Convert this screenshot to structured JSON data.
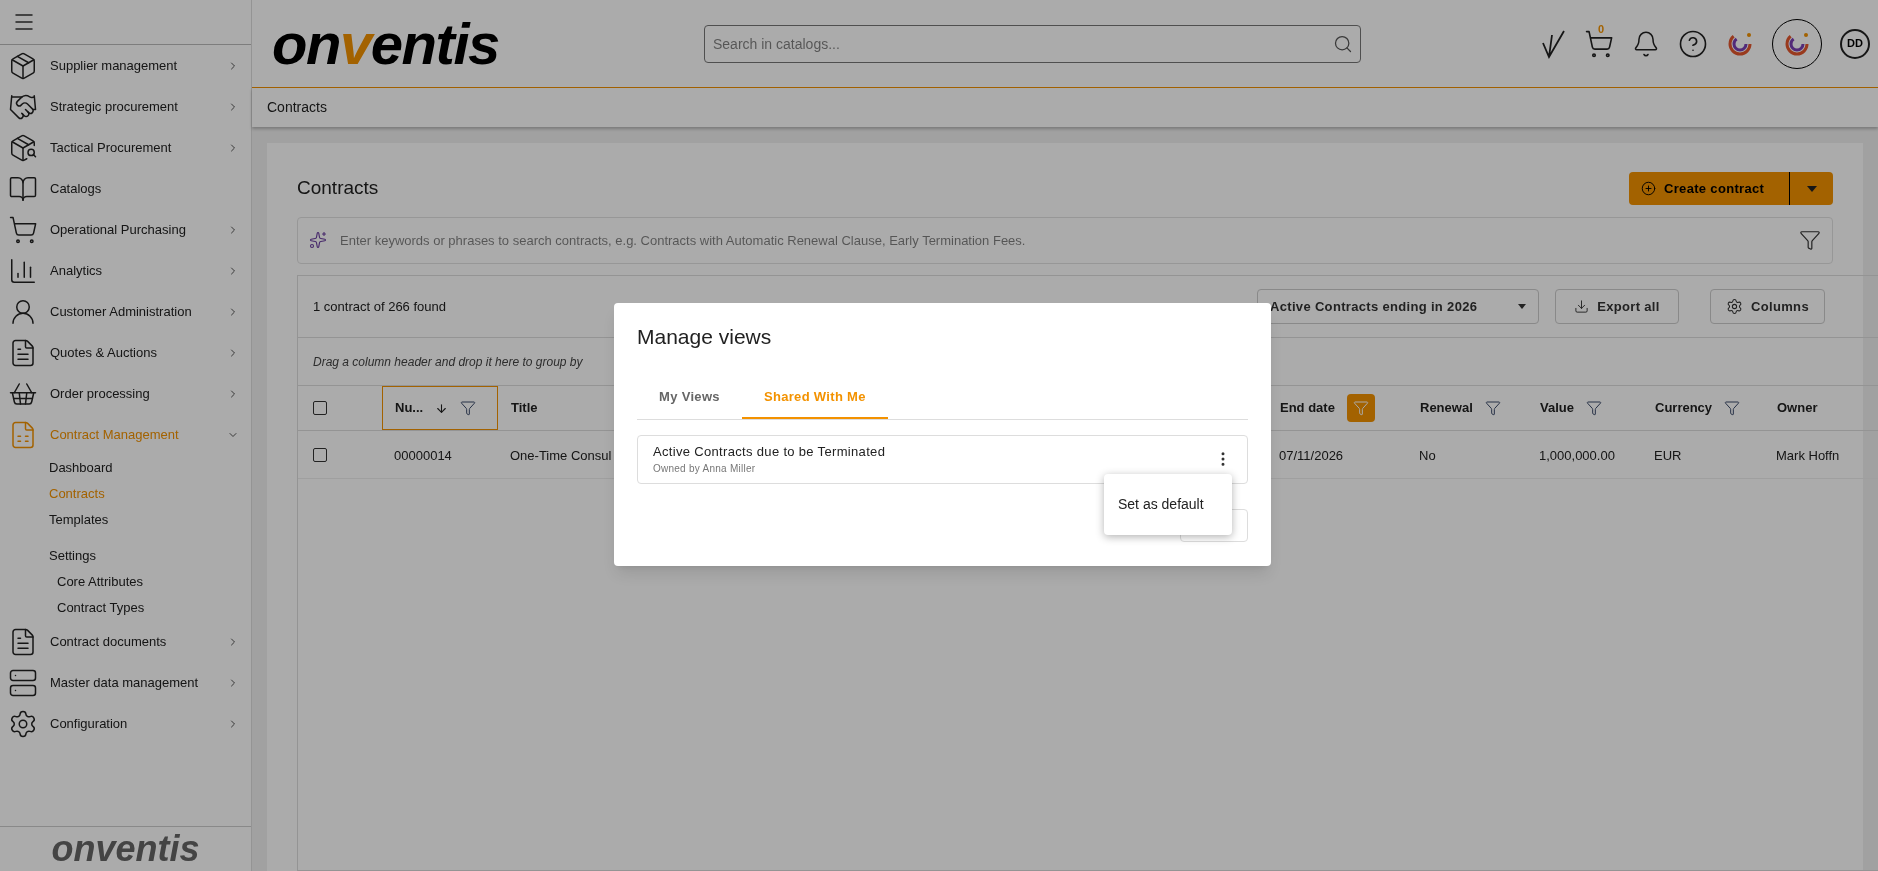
{
  "sidebar": {
    "items": [
      {
        "label": "Supplier management",
        "expandable": true,
        "expanded": false,
        "selected": false
      },
      {
        "label": "Strategic procurement",
        "expandable": true,
        "expanded": false,
        "selected": false
      },
      {
        "label": "Tactical Procurement",
        "expandable": true,
        "expanded": false,
        "selected": false
      },
      {
        "label": "Catalogs",
        "expandable": false,
        "expanded": false,
        "selected": false
      },
      {
        "label": "Operational Purchasing",
        "expandable": true,
        "expanded": false,
        "selected": false
      },
      {
        "label": "Analytics",
        "expandable": true,
        "expanded": false,
        "selected": false
      },
      {
        "label": "Customer Administration",
        "expandable": true,
        "expanded": false,
        "selected": false
      },
      {
        "label": "Quotes & Auctions",
        "expandable": true,
        "expanded": false,
        "selected": false
      },
      {
        "label": "Order processing",
        "expandable": true,
        "expanded": false,
        "selected": false
      },
      {
        "label": "Contract Management",
        "expandable": true,
        "expanded": true,
        "selected": true,
        "children": [
          {
            "kind": "link",
            "label": "Dashboard",
            "selected": false
          },
          {
            "kind": "link",
            "label": "Contracts",
            "selected": true
          },
          {
            "kind": "link",
            "label": "Templates",
            "selected": false
          },
          {
            "kind": "section",
            "label": "Settings",
            "children": [
              {
                "label": "Core Attributes",
                "selected": false
              },
              {
                "label": "Contract Types",
                "selected": false
              }
            ]
          }
        ]
      },
      {
        "label": "Contract documents",
        "expandable": true,
        "expanded": false,
        "selected": false
      },
      {
        "label": "Master data management",
        "expandable": true,
        "expanded": false,
        "selected": false
      },
      {
        "label": "Configuration",
        "expandable": true,
        "expanded": false,
        "selected": false
      }
    ],
    "footer_logo": "onventis"
  },
  "header": {
    "logo": {
      "prefix": "on",
      "accent": "v",
      "suffix": "entis"
    },
    "search": {
      "placeholder": "Search in catalogs..."
    },
    "cart_count": "0",
    "avatar": "DD"
  },
  "breadcrumb": "Contracts",
  "page": {
    "title": "Contracts",
    "create_button": "Create contract",
    "smart_search": {
      "placeholder": "Enter keywords or phrases to search contracts, e.g. Contracts with Automatic Renewal Clause, Early Termination Fees."
    },
    "toolbar": {
      "count": "1 contract of 266 found",
      "view": "Active Contracts ending in 2026",
      "export": "Export all",
      "columns": "Columns"
    },
    "group_hint": "Drag a column header and drop it here to group by",
    "table": {
      "all_checked": false,
      "columns": [
        {
          "label": "Nu...",
          "sorted_descending": true,
          "filterable": true,
          "filtered": false,
          "focused": true
        },
        {
          "label": "Title",
          "sorted_descending": false,
          "filterable": false,
          "filtered": false,
          "focused": false
        },
        {
          "label": "End date",
          "sorted_descending": false,
          "filterable": true,
          "filtered": true,
          "focused": false
        },
        {
          "label": "Renewal",
          "sorted_descending": false,
          "filterable": true,
          "filtered": false,
          "focused": false
        },
        {
          "label": "Value",
          "sorted_descending": false,
          "filterable": true,
          "filtered": false,
          "focused": false
        },
        {
          "label": "Currency",
          "sorted_descending": false,
          "filterable": true,
          "filtered": false,
          "focused": false
        },
        {
          "label": "Owner",
          "sorted_descending": false,
          "filterable": false,
          "filtered": false,
          "focused": false
        }
      ],
      "rows": [
        {
          "checked": false,
          "cells": [
            "00000014",
            "One-Time Consul",
            "07/11/2026",
            "No",
            "1,000,000.00",
            "EUR",
            "Mark Hoffn"
          ]
        }
      ]
    }
  },
  "dialog": {
    "title": "Manage views",
    "tabs": [
      {
        "label": "My Views",
        "selected": false
      },
      {
        "label": "Shared With Me",
        "selected": true
      }
    ],
    "views": [
      {
        "name": "Active Contracts due to be Terminated",
        "owner": "Owned by Anna Miller"
      }
    ],
    "menu": {
      "items": [
        "Set as default"
      ]
    }
  }
}
